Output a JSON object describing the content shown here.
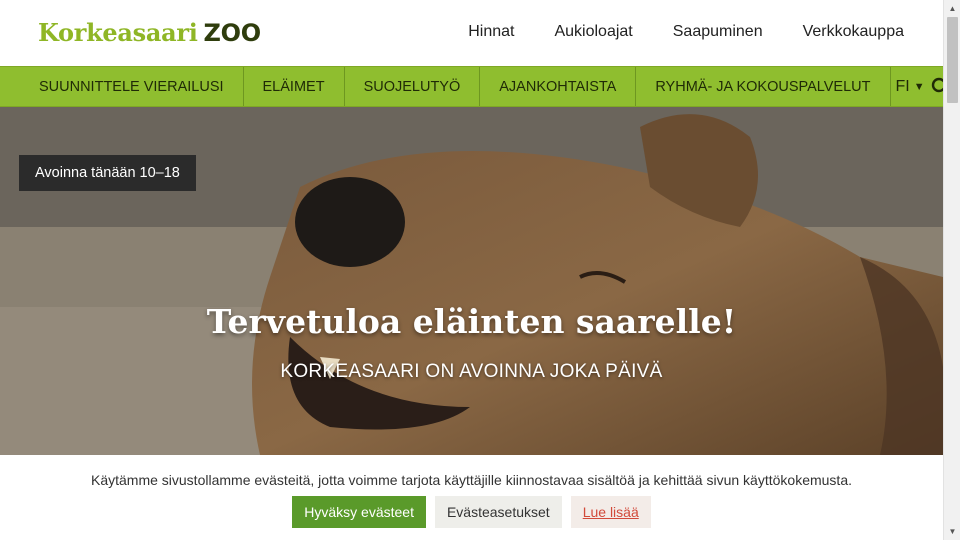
{
  "brand": {
    "name_part1": "Korkeasaari",
    "name_part2": "ZOO",
    "color": "#8fb626"
  },
  "top_links": [
    "Hinnat",
    "Aukioloajat",
    "Saapuminen",
    "Verkkokauppa"
  ],
  "nav": {
    "items": [
      "SUUNNITTELE VIERAILUSI",
      "ELÄIMET",
      "SUOJELUTYÖ",
      "AJANKOHTAISTA",
      "RYHMÄ- JA KOKOUSPALVELUT"
    ],
    "language": "FI",
    "language_caret": "▼",
    "search_icon": "search-icon",
    "color": "#8fbe2f"
  },
  "hero": {
    "open_badge": "Avoinna tänään 10–18",
    "title": "Tervetuloa eläinten saarelle!",
    "subtitle": "KORKEASAARI ON AVOINNA JOKA PÄIVÄ"
  },
  "cookie": {
    "message": "Käytämme sivustollamme evästeitä, jotta voimme tarjota käyttäjille kiinnostavaa sisältöä ja kehittää sivun käyttökokemusta.",
    "accept_label": "Hyväksy evästeet",
    "settings_label": "Evästeasetukset",
    "more_label": "Lue lisää"
  },
  "scrollbar": {
    "up_arrow": "▲",
    "down_arrow": "▼"
  }
}
